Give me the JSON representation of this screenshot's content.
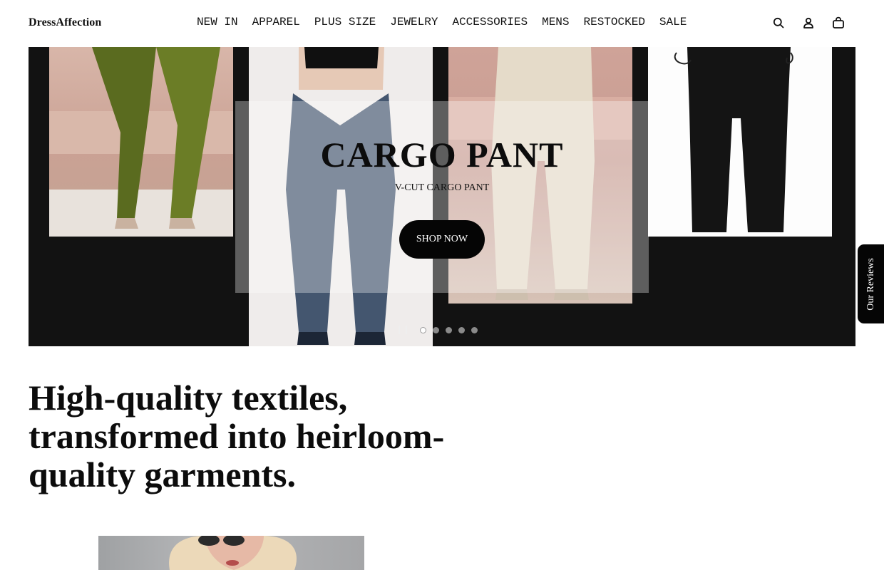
{
  "header": {
    "logo": "DressAffection",
    "nav": [
      "NEW IN",
      "APPAREL",
      "PLUS SIZE",
      "JEWELRY",
      "ACCESSORIES",
      "MENS",
      "RESTOCKED",
      "SALE"
    ],
    "icons": [
      "search-icon",
      "account-icon",
      "cart-icon"
    ]
  },
  "hero": {
    "title": "CARGO PANT",
    "subtitle": "V-CUT CARGO PANT",
    "cta": "SHOP NOW",
    "slides_total": 5,
    "active_slide": 1,
    "panels": [
      {
        "color": "olive green"
      },
      {
        "color": "denim blue"
      },
      {
        "color": "beige"
      },
      {
        "color": "black"
      }
    ]
  },
  "reviews_tab": "Our Reviews",
  "tagline": "High-quality textiles, transformed into heirloom-quality garments.",
  "colors": {
    "background": "#ffffff",
    "hero_bg": "#121212",
    "button": "#050505",
    "text": "#111111"
  }
}
